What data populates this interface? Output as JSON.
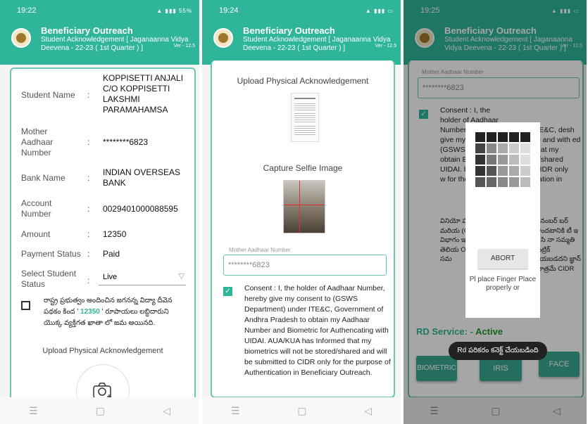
{
  "p1": {
    "status": {
      "time": "19:22",
      "right": "55%"
    },
    "header": {
      "title": "Beneficiary Outreach",
      "subtitle": "Student Acknowledgement [ Jaganaanna Vidya Deevena - 22-23 ( 1st Quarter ) ]",
      "version": "Ver - 12.5"
    },
    "rows": [
      {
        "label": "Student Name",
        "value": "KOPPISETTI ANJALI C/O KOPPISETTI LAKSHMI PARAMAHAMSA"
      },
      {
        "label": "Mother Aadhaar Number",
        "value": "********6823"
      },
      {
        "label": "Bank Name",
        "value": "INDIAN OVERSEAS BANK"
      },
      {
        "label": "Account Number",
        "value": "0029401000088595"
      },
      {
        "label": "Amount",
        "value": "12350"
      },
      {
        "label": "Payment Status",
        "value": "Paid"
      }
    ],
    "select": {
      "label": "Select Student Status",
      "value": "Live"
    },
    "telugu_pre": "రాష్ట్ర ప్రభుత్వం అందించిన జగనన్న విద్యా దీవెన పథకం కింద '",
    "telugu_amount": " 12350 ",
    "telugu_post": "' రూపాయలు లబ్ధిదారుని యొక్క వ్యక్తిగత ఖాతా లో జమ అయినది.",
    "upload_label": "Upload Physical Acknowledgement"
  },
  "p2": {
    "status": {
      "time": "19:24"
    },
    "header": {
      "title": "Beneficiary Outreach",
      "subtitle": "Student Acknowledgement [ Jaganaanna Vidya Deevena - 22-23 ( 1st Quarter ) ]",
      "version": "Ver - 12.5"
    },
    "upload_label": "Upload Physical Acknowledgement",
    "selfie_label": "Capture Selfie Image",
    "mother_label": "Mother Aadhaar Number",
    "mother_value": "********6823",
    "consent": "Consent : I, the holder of Aadhaar Number, hereby give my consent to (GSWS Department) under ITE&C, Government of Andhra Pradesh to obtain my Aadhaar Number and Biometric for Authencating with UIDAI. AUA/KUA has Informed that my biometrics will not be stored/shared and will be submitted to CIDR only for the purpose of Authentication in Beneficiary Outreach."
  },
  "p3": {
    "status": {
      "time": "19:25"
    },
    "header": {
      "title": "Beneficiary Outreach",
      "subtitle": "Student Acknowledgement [ Jaganaanna Vidya Deevena - 22-23 ( 1st Quarter ) ]",
      "version": "Ver - 12.5"
    },
    "mother_label": "Mother Aadhaar Number",
    "mother_value": "********6823",
    "consent_left": "Consent : I, the holder of Aadhaar Number, hereby give my consent to (GSWS Gover obtain Biome UIDAI. biome and w for the Benefi",
    "consent_right": "TE&C, desh to and with ed that my d/shared CIDR only cation in",
    "telugu_left": "వినియో హోల్డర్, మరియ (GSWS విభాగం ఇస్తున్న నిల్వ తెలియ Outrea కు సమ",
    "telugu_right": "ర్ నంబర్ బర్ పొందటానికి టీ ఇ & సి నా సమ్మతి మెట్రిక్ చేయబడదని జ్ఞాన్ మాత్రమే CIDR",
    "abort": "ABORT",
    "place_finger": "Pl place Finger Place properly or",
    "rd_label": "RD Service: -",
    "rd_status": "Active",
    "toast": "Rd పరికరం కనెక్ట్ చేయబడింది",
    "buttons": [
      "BIOMETRIC",
      "IRIS",
      "FACE"
    ],
    "colors": {
      "active": "#1e9b2a",
      "accent": "#2fb59a"
    }
  }
}
